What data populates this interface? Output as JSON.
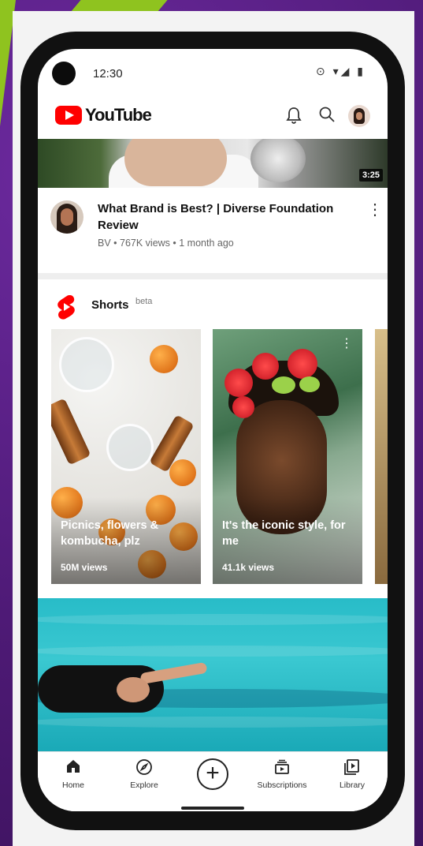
{
  "status_bar": {
    "time": "12:30",
    "icons": "⊙ ▾◢ ▮"
  },
  "app": {
    "logo_text": "YouTube"
  },
  "top_video": {
    "duration": "3:25",
    "title": "What Brand is Best? | Diverse Foundation Review",
    "channel": "BV",
    "views": "767K views",
    "age": "1 month ago",
    "subtitle": "BV • 767K views • 1 month ago"
  },
  "shorts": {
    "title": "Shorts",
    "badge": "beta",
    "items": [
      {
        "title": "Picnics, flowers & kombucha, plz",
        "views": "50M views"
      },
      {
        "title": "It's the iconic style, for me",
        "views": "41.1k views"
      }
    ]
  },
  "bottom_nav": {
    "items": [
      {
        "label": "Home",
        "icon": "home-icon"
      },
      {
        "label": "Explore",
        "icon": "compass-icon"
      },
      {
        "label": "",
        "icon": "create-icon"
      },
      {
        "label": "Subscriptions",
        "icon": "subscriptions-icon"
      },
      {
        "label": "Library",
        "icon": "library-icon"
      }
    ]
  },
  "colors": {
    "brand_red": "#ff0000",
    "background_purple": "#5b1f86",
    "accent_lime": "#8fc31f"
  }
}
